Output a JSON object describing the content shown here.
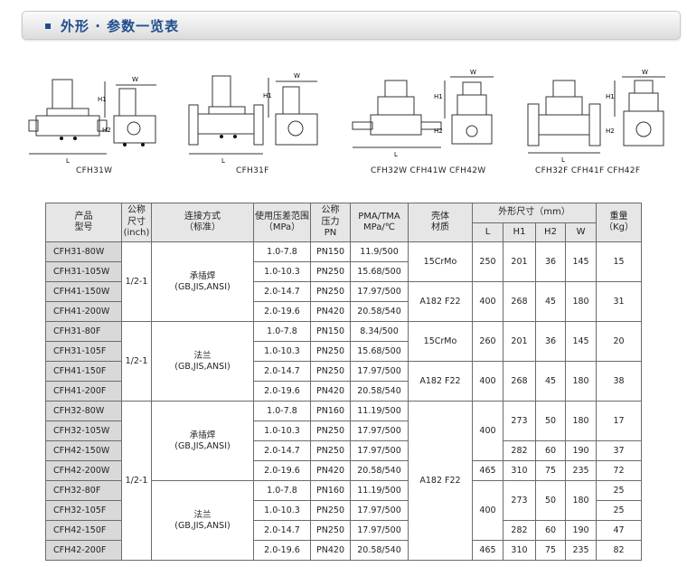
{
  "header": {
    "title": "外形 · 参数一览表"
  },
  "figures": {
    "group1": {
      "caption": "CFH31W"
    },
    "group2": {
      "caption": "CFH31F"
    },
    "group3": {
      "caption": "CFH32W  CFH41W  CFH42W"
    },
    "group4": {
      "caption": "CFH32F  CFH41F  CFH42F"
    },
    "dim_labels": {
      "l": "L",
      "h1": "H1",
      "h2": "H2",
      "w": "W"
    }
  },
  "table": {
    "headers": {
      "model": "产品\n型号",
      "size": "公称\n尺寸\n(inch)",
      "connection": "连接方式\n（标准）",
      "pressure_range": "使用压差范围\n（MPa）",
      "pn": "公称\n压力\nPN",
      "pma_tma": "PMA/TMA\nMPa/℃",
      "material": "壳体\n材质",
      "dims": "外形尺寸（mm）",
      "l": "L",
      "h1": "H1",
      "h2": "H2",
      "w": "W",
      "weight": "重量\n（Kg）"
    },
    "size_value": "1/2-1",
    "conn": {
      "socket_weld": "承插焊\n(GB,JIS,ANSI)",
      "flange": "法兰\n(GB,JIS,ANSI)"
    },
    "rows": [
      {
        "model": "CFH31-80W",
        "range": "1.0-7.8",
        "pn": "PN150",
        "pma": "11.9/500"
      },
      {
        "model": "CFH31-105W",
        "range": "1.0-10.3",
        "pn": "PN250",
        "pma": "15.68/500"
      },
      {
        "model": "CFH41-150W",
        "range": "2.0-14.7",
        "pn": "PN250",
        "pma": "17.97/500"
      },
      {
        "model": "CFH41-200W",
        "range": "2.0-19.6",
        "pn": "PN420",
        "pma": "20.58/540"
      },
      {
        "model": "CFH31-80F",
        "range": "1.0-7.8",
        "pn": "PN150",
        "pma": "8.34/500"
      },
      {
        "model": "CFH31-105F",
        "range": "1.0-10.3",
        "pn": "PN250",
        "pma": "15.68/500"
      },
      {
        "model": "CFH41-150F",
        "range": "2.0-14.7",
        "pn": "PN250",
        "pma": "17.97/500"
      },
      {
        "model": "CFH41-200F",
        "range": "2.0-19.6",
        "pn": "PN420",
        "pma": "20.58/540"
      },
      {
        "model": "CFH32-80W",
        "range": "1.0-7.8",
        "pn": "PN160",
        "pma": "11.19/500"
      },
      {
        "model": "CFH32-105W",
        "range": "1.0-10.3",
        "pn": "PN250",
        "pma": "17.97/500"
      },
      {
        "model": "CFH42-150W",
        "range": "2.0-14.7",
        "pn": "PN250",
        "pma": "17.97/500"
      },
      {
        "model": "CFH42-200W",
        "range": "2.0-19.6",
        "pn": "PN420",
        "pma": "20.58/540"
      },
      {
        "model": "CFH32-80F",
        "range": "1.0-7.8",
        "pn": "PN160",
        "pma": "11.19/500"
      },
      {
        "model": "CFH32-105F",
        "range": "1.0-10.3",
        "pn": "PN250",
        "pma": "17.97/500"
      },
      {
        "model": "CFH42-150F",
        "range": "2.0-14.7",
        "pn": "PN250",
        "pma": "17.97/500"
      },
      {
        "model": "CFH42-200F",
        "range": "2.0-19.6",
        "pn": "PN420",
        "pma": "20.58/540"
      }
    ],
    "groups": {
      "a": {
        "material1": "15CrMo",
        "material2": "A182 F22",
        "l1": "250",
        "h1_1": "201",
        "h2_1": "36",
        "w1": "145",
        "kg1": "15",
        "l2": "400",
        "h1_2": "268",
        "h2_2": "45",
        "w2": "180",
        "kg2": "31"
      },
      "b": {
        "material1": "15CrMo",
        "material2": "A182 F22",
        "l1": "260",
        "h1_1": "201",
        "h2_1": "36",
        "w1": "145",
        "kg1": "20",
        "l2": "400",
        "h1_2": "268",
        "h2_2": "45",
        "w2": "180",
        "kg2": "38"
      },
      "c": {
        "material": "A182 F22",
        "l_a": "400",
        "h1_a": "273",
        "h2_a": "50",
        "w_a": "180",
        "kg1": "17",
        "h1_b": "282",
        "h2_b": "60",
        "w_b": "190",
        "kg3": "37",
        "l_c": "465",
        "h1_c": "310",
        "h2_c": "75",
        "w_c": "235",
        "kg4": "72"
      },
      "d": {
        "l_a": "400",
        "h1_a": "273",
        "h2_a": "50",
        "w_a": "180",
        "kg1": "25",
        "kg2": "25",
        "h1_b": "282",
        "h2_b": "60",
        "w_b": "190",
        "kg3": "47",
        "l_c": "465",
        "h1_c": "310",
        "h2_c": "75",
        "w_c": "235",
        "kg4": "82"
      }
    }
  }
}
